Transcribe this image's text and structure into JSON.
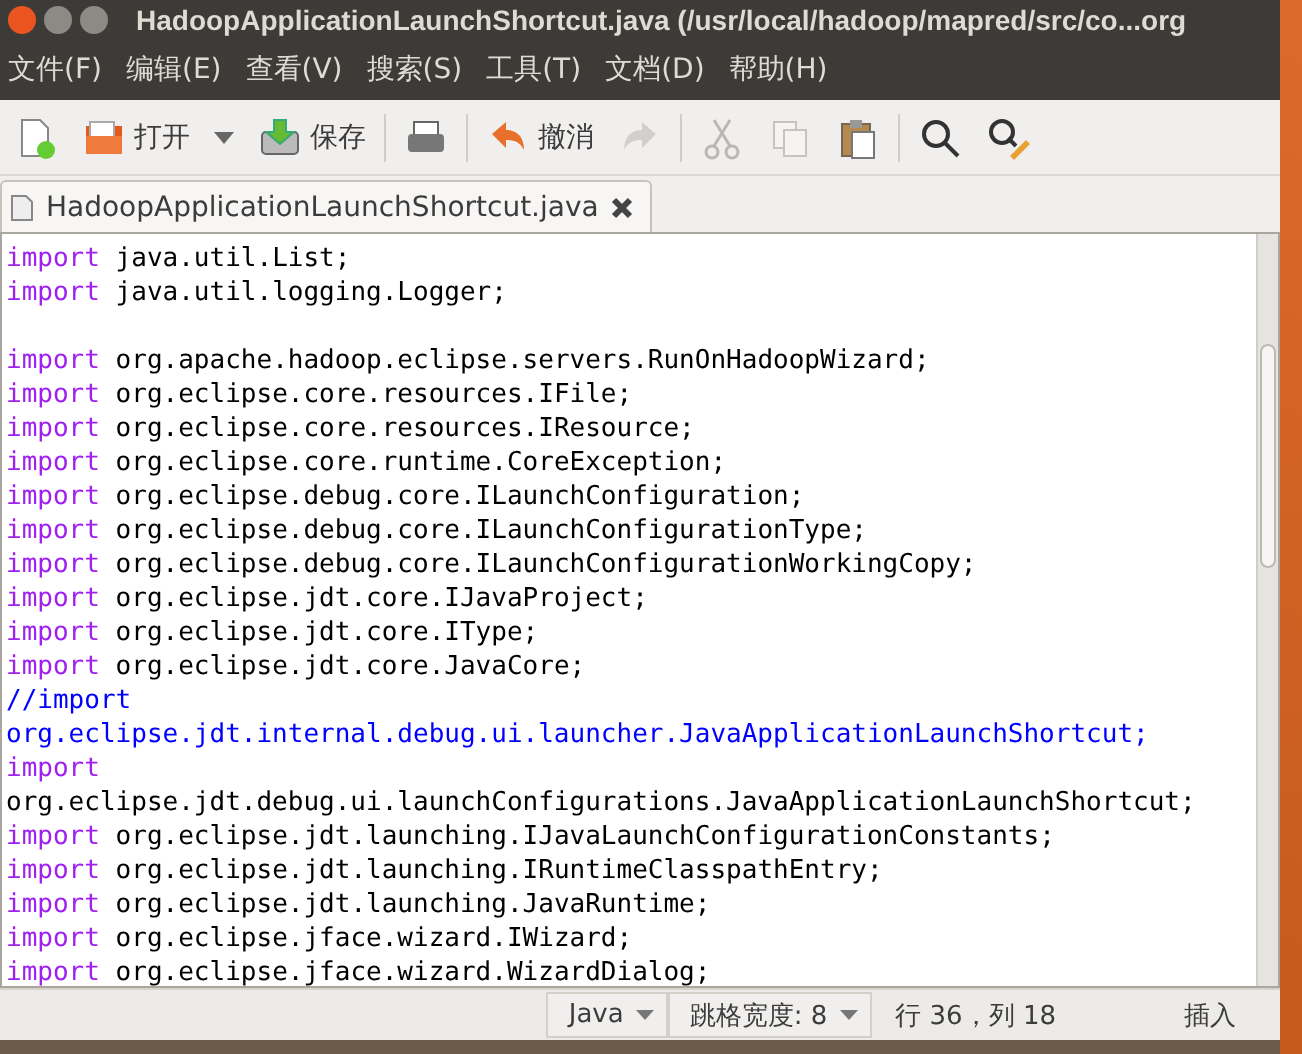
{
  "window": {
    "title": "HadoopApplicationLaunchShortcut.java (/usr/local/hadoop/mapred/src/co...org"
  },
  "menu": [
    "文件(F)",
    "编辑(E)",
    "查看(V)",
    "搜索(S)",
    "工具(T)",
    "文档(D)",
    "帮助(H)"
  ],
  "toolbar": [
    {
      "kind": "new",
      "disabled": false
    },
    {
      "kind": "open",
      "label": "打开",
      "disabled": false
    },
    {
      "kind": "dropdown",
      "disabled": false
    },
    {
      "kind": "save",
      "label": "保存",
      "disabled": false
    },
    {
      "kind": "separator"
    },
    {
      "kind": "print",
      "disabled": false
    },
    {
      "kind": "separator"
    },
    {
      "kind": "undo",
      "label": "撤消",
      "disabled": false
    },
    {
      "kind": "redo",
      "disabled": true
    },
    {
      "kind": "separator"
    },
    {
      "kind": "cut",
      "disabled": true
    },
    {
      "kind": "copy",
      "disabled": true
    },
    {
      "kind": "paste",
      "disabled": false
    },
    {
      "kind": "separator"
    },
    {
      "kind": "search",
      "disabled": false
    },
    {
      "kind": "replace",
      "disabled": false
    }
  ],
  "tabs": [
    {
      "label": "HadoopApplicationLaunchShortcut.java",
      "selected": true
    }
  ],
  "code": [
    {
      "kind": "import",
      "keyword": "import",
      "text": "java.util.List;"
    },
    {
      "kind": "import",
      "keyword": "import",
      "text": "java.util.logging.Logger;"
    },
    {
      "kind": "blank"
    },
    {
      "kind": "import",
      "keyword": "import",
      "text": "org.apache.hadoop.eclipse.servers.RunOnHadoopWizard;"
    },
    {
      "kind": "import",
      "keyword": "import",
      "text": "org.eclipse.core.resources.IFile;"
    },
    {
      "kind": "import",
      "keyword": "import",
      "text": "org.eclipse.core.resources.IResource;"
    },
    {
      "kind": "import",
      "keyword": "import",
      "text": "org.eclipse.core.runtime.CoreException;"
    },
    {
      "kind": "import",
      "keyword": "import",
      "text": "org.eclipse.debug.core.ILaunchConfiguration;"
    },
    {
      "kind": "import",
      "keyword": "import",
      "text": "org.eclipse.debug.core.ILaunchConfigurationType;"
    },
    {
      "kind": "import",
      "keyword": "import",
      "text": "org.eclipse.debug.core.ILaunchConfigurationWorkingCopy;"
    },
    {
      "kind": "import",
      "keyword": "import",
      "text": "org.eclipse.jdt.core.IJavaProject;"
    },
    {
      "kind": "import",
      "keyword": "import",
      "text": "org.eclipse.jdt.core.IType;"
    },
    {
      "kind": "import",
      "keyword": "import",
      "text": "org.eclipse.jdt.core.JavaCore;"
    },
    {
      "kind": "comment",
      "text": "//import"
    },
    {
      "kind": "comment",
      "text": "org.eclipse.jdt.internal.debug.ui.launcher.JavaApplicationLaunchShortcut;"
    },
    {
      "kind": "keyword",
      "text": "import"
    },
    {
      "kind": "plain",
      "text": "org.eclipse.jdt.debug.ui.launchConfigurations.JavaApplicationLaunchShortcut;"
    },
    {
      "kind": "import",
      "keyword": "import",
      "text": "org.eclipse.jdt.launching.IJavaLaunchConfigurationConstants;"
    },
    {
      "kind": "import",
      "keyword": "import",
      "text": "org.eclipse.jdt.launching.IRuntimeClasspathEntry;"
    },
    {
      "kind": "import",
      "keyword": "import",
      "text": "org.eclipse.jdt.launching.JavaRuntime;"
    },
    {
      "kind": "import",
      "keyword": "import",
      "text": "org.eclipse.jface.wizard.IWizard;"
    },
    {
      "kind": "import",
      "keyword": "import",
      "text": "org.eclipse.jface.wizard.WizardDialog;"
    }
  ],
  "status_bar": {
    "language": "Java",
    "tab_width": "跳格宽度: 8",
    "position": "行 36，列 18",
    "mode": "插入"
  }
}
